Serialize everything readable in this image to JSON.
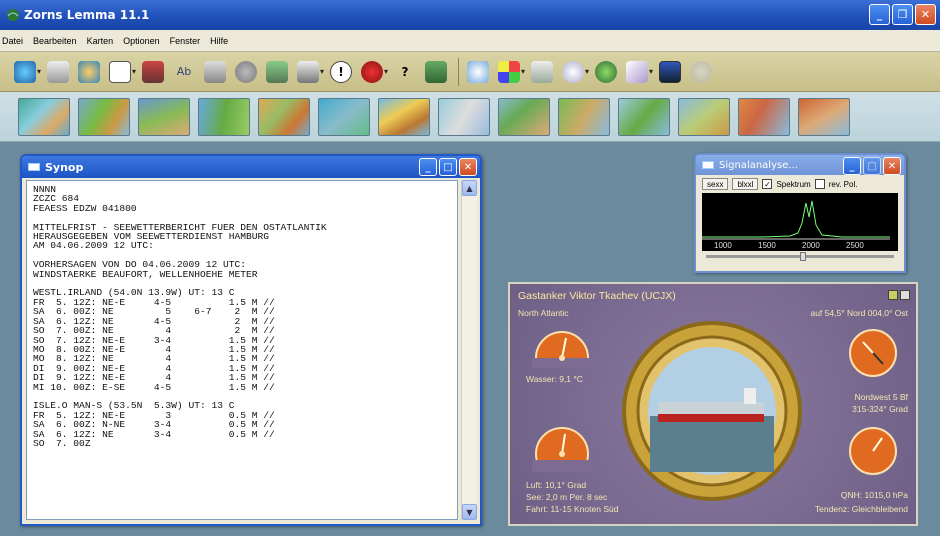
{
  "app": {
    "title": "Zorns Lemma 11.1"
  },
  "menu": [
    "Datei",
    "Bearbeiten",
    "Karten",
    "Optionen",
    "Fenster",
    "Hilfe"
  ],
  "synop": {
    "title": "Synop",
    "lines": [
      "NNNN",
      "ZCZC 684",
      "FEAESS EDZW 041800",
      "",
      "MITTELFRIST - SEEWETTERBERICHT FUER DEN OSTATLANTIK",
      "HERAUSGEGEBEN VOM SEEWETTERDIENST HAMBURG",
      "AM 04.06.2009 12 UTC:",
      "",
      "VORHERSAGEN VON DO 04.06.2009 12 UTC:",
      "WINDSTAERKE BEAUFORT, WELLENHOEHE METER",
      "",
      "WESTL.IRLAND (54.0N 13.9W) UT: 13 C",
      "FR  5. 12Z: NE-E     4-5          1.5 M //",
      "SA  6. 00Z: NE         5    6-7    2  M //",
      "SA  6. 12Z: NE       4-5           2  M //",
      "SO  7. 00Z: NE         4           2  M //",
      "SO  7. 12Z: NE-E     3-4          1.5 M //",
      "MO  8. 00Z: NE-E       4          1.5 M //",
      "MO  8. 12Z: NE         4          1.5 M //",
      "DI  9. 00Z: NE-E       4          1.5 M //",
      "DI  9. 12Z: NE-E       4          1.5 M //",
      "MI 10. 00Z: E-SE     4-5          1.5 M //",
      "",
      "ISLE.O MAN-S (53.5N  5.3W) UT: 13 C",
      "FR  5. 12Z: NE-E       3          0.5 M //",
      "SA  6. 00Z: N-NE     3-4          0.5 M //",
      "SA  6. 12Z: NE       3-4          0.5 M //",
      "SO  7. 00Z"
    ]
  },
  "signal": {
    "title": "Signalanalyse...",
    "btn1": "sexx",
    "btn2": "blxxl",
    "spektrum": "Spektrum",
    "revpol": "rev. Pol.",
    "ticks": [
      "1000",
      "1500",
      "2000",
      "2500"
    ]
  },
  "ship": {
    "title": "Gastanker Viktor Tkachev (UCJX)",
    "region": "North Atlantic",
    "pos": "auf 54,5° Nord 004,0° Ost",
    "wasser": "Wasser: 9,1 °C",
    "wind": "Nordwest 5 Bf",
    "winddir": "315-324° Grad",
    "luft": "Luft: 10,1° Grad",
    "see": "See: 2,0 m Per. 8 sec",
    "fahrt": "Fahrt: 11-15 Knoten Süd",
    "qnh": "QNH: 1015,0 hPa",
    "tendenz": "Tendenz: Gleichbleibend"
  }
}
